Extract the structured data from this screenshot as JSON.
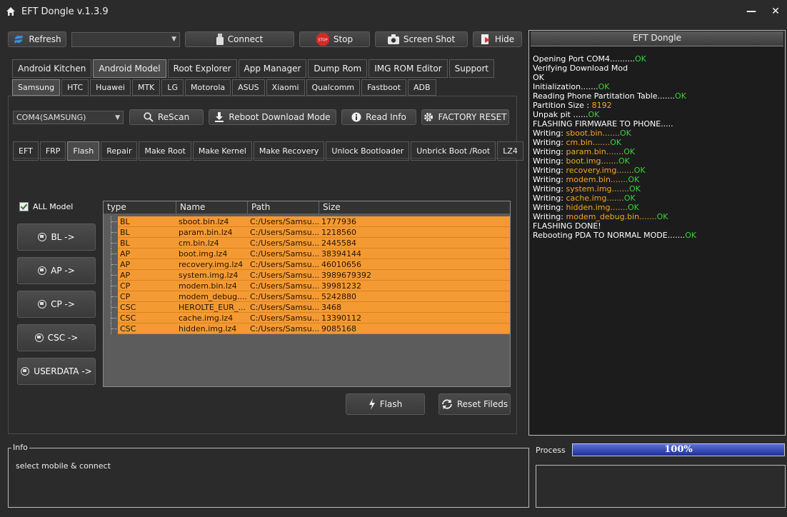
{
  "window": {
    "title": "EFT Dongle  v.1.3.9",
    "minimize": "—",
    "close": "✕"
  },
  "toolbar": {
    "refresh": "Refresh",
    "port_select": "",
    "connect": "Connect",
    "stop": "Stop",
    "stop_badge": "STOP",
    "screenshot": "Screen Shot",
    "hide": "Hide"
  },
  "main_tabs": [
    "Android Kitchen",
    "Android Model",
    "Root Explorer",
    "App Manager",
    "Dump Rom",
    "IMG ROM Editor",
    "Support"
  ],
  "main_tab_active": "Android Model",
  "brand_tabs": [
    "Samsung",
    "HTC",
    "Huawei",
    "MTK",
    "LG",
    "Motorola",
    "ASUS",
    "Xiaomi",
    "Qualcomm",
    "Fastboot",
    "ADB"
  ],
  "brand_tab_active": "Samsung",
  "device_bar": {
    "port": "COM4(SAMSUNG)",
    "rescan": "ReScan",
    "reboot_download": "Reboot  Download Mode",
    "read_info": "Read Info",
    "factory_reset": "FACTORY RESET"
  },
  "func_tabs": [
    "EFT",
    "FRP",
    "Flash",
    "Repair",
    "Make Root",
    "Make Kernel",
    "Make Recovery",
    "Unlock Bootloader",
    "Unbrick Boot /Root",
    "LZ4"
  ],
  "func_tab_active": "Flash",
  "flash": {
    "all_model_label": "ALL Model",
    "all_model_checked": true,
    "side_buttons": [
      "BL ->",
      "AP ->",
      "CP ->",
      "CSC ->",
      "USERDATA ->"
    ],
    "columns": [
      "type",
      "Name",
      "Path",
      "Size"
    ],
    "rows": [
      {
        "type": "BL",
        "name": "sboot.bin.lz4",
        "path": "C:/Users/Samsu...",
        "size": "1777936"
      },
      {
        "type": "BL",
        "name": "param.bin.lz4",
        "path": "C:/Users/Samsu...",
        "size": "1218560"
      },
      {
        "type": "BL",
        "name": "cm.bin.lz4",
        "path": "C:/Users/Samsu...",
        "size": "2445584"
      },
      {
        "type": "AP",
        "name": "boot.img.lz4",
        "path": "C:/Users/Samsu...",
        "size": "38394144"
      },
      {
        "type": "AP",
        "name": "recovery.img.lz4",
        "path": "C:/Users/Samsu...",
        "size": "46010656"
      },
      {
        "type": "AP",
        "name": "system.img.lz4",
        "path": "C:/Users/Samsu...",
        "size": "3989679392"
      },
      {
        "type": "CP",
        "name": "modem.bin.lz4",
        "path": "C:/Users/Samsu...",
        "size": "39981232"
      },
      {
        "type": "CP",
        "name": "modem_debug....",
        "path": "C:/Users/Samsu...",
        "size": "5242880"
      },
      {
        "type": "CSC",
        "name": "HEROLTE_EUR_...",
        "path": "C:/Users/Samsu...",
        "size": "3468"
      },
      {
        "type": "CSC",
        "name": "cache.img.lz4",
        "path": "C:/Users/Samsu...",
        "size": "13390112"
      },
      {
        "type": "CSC",
        "name": "hidden.img.lz4",
        "path": "C:/Users/Samsu...",
        "size": "9085168"
      }
    ],
    "flash_button": "Flash",
    "reset_button": "Reset Fileds"
  },
  "log": {
    "title": "EFT Dongle",
    "lines": [
      [
        {
          "t": "Opening Port COM4..........",
          "c": "w"
        },
        {
          "t": "OK",
          "c": "g"
        }
      ],
      [
        {
          "t": "Verifying Download Mod",
          "c": "w"
        }
      ],
      [
        {
          "t": "OK",
          "c": "w"
        }
      ],
      [
        {
          "t": "Initialization.......",
          "c": "w"
        },
        {
          "t": "OK",
          "c": "g"
        }
      ],
      [
        {
          "t": "Reading Phone Partitation Table.......",
          "c": "w"
        },
        {
          "t": "OK",
          "c": "g"
        }
      ],
      [
        {
          "t": "Partition Size : ",
          "c": "w"
        },
        {
          "t": "8192",
          "c": "o"
        }
      ],
      [
        {
          "t": "Unpak pit ......",
          "c": "w"
        },
        {
          "t": "OK",
          "c": "g"
        }
      ],
      [
        {
          "t": "FLASHING FIRMWARE TO PHONE.....",
          "c": "w"
        }
      ],
      [
        {
          "t": "Writing: ",
          "c": "w"
        },
        {
          "t": "sboot.bin.......",
          "c": "o"
        },
        {
          "t": "OK",
          "c": "g"
        }
      ],
      [
        {
          "t": "Writing: ",
          "c": "w"
        },
        {
          "t": "cm.bin.......",
          "c": "o"
        },
        {
          "t": "OK",
          "c": "g"
        }
      ],
      [
        {
          "t": "Writing: ",
          "c": "w"
        },
        {
          "t": "param.bin.......",
          "c": "o"
        },
        {
          "t": "OK",
          "c": "g"
        }
      ],
      [
        {
          "t": "Writing: ",
          "c": "w"
        },
        {
          "t": "boot.img.......",
          "c": "o"
        },
        {
          "t": "OK",
          "c": "g"
        }
      ],
      [
        {
          "t": "Writing: ",
          "c": "w"
        },
        {
          "t": "recovery.img.......",
          "c": "o"
        },
        {
          "t": "OK",
          "c": "g"
        }
      ],
      [
        {
          "t": "Writing: ",
          "c": "w"
        },
        {
          "t": "modem.bin.......",
          "c": "o"
        },
        {
          "t": "OK",
          "c": "g"
        }
      ],
      [
        {
          "t": "Writing: ",
          "c": "w"
        },
        {
          "t": "system.img.......",
          "c": "o"
        },
        {
          "t": "OK",
          "c": "g"
        }
      ],
      [
        {
          "t": "Writing: ",
          "c": "w"
        },
        {
          "t": "cache.img.......",
          "c": "o"
        },
        {
          "t": "OK",
          "c": "g"
        }
      ],
      [
        {
          "t": "Writing: ",
          "c": "w"
        },
        {
          "t": "hidden.img.......",
          "c": "o"
        },
        {
          "t": "OK",
          "c": "g"
        }
      ],
      [
        {
          "t": "Writing: ",
          "c": "w"
        },
        {
          "t": "modem_debug.bin.......",
          "c": "o"
        },
        {
          "t": "OK",
          "c": "g"
        }
      ],
      [
        {
          "t": "FLASHING DONE!",
          "c": "w"
        }
      ],
      [
        {
          "t": "Rebooting PDA TO NORMAL MODE.......",
          "c": "w"
        },
        {
          "t": "OK",
          "c": "g"
        }
      ]
    ]
  },
  "info": {
    "label": "Info",
    "text": "select mobile & connect"
  },
  "process": {
    "label": "Process",
    "percent": 100,
    "percent_text": "100%"
  },
  "colors": {
    "row_bg": "#f39a33",
    "ok_green": "#3ad13a",
    "value_orange": "#f6a623",
    "progress": "#1f2f9c"
  }
}
